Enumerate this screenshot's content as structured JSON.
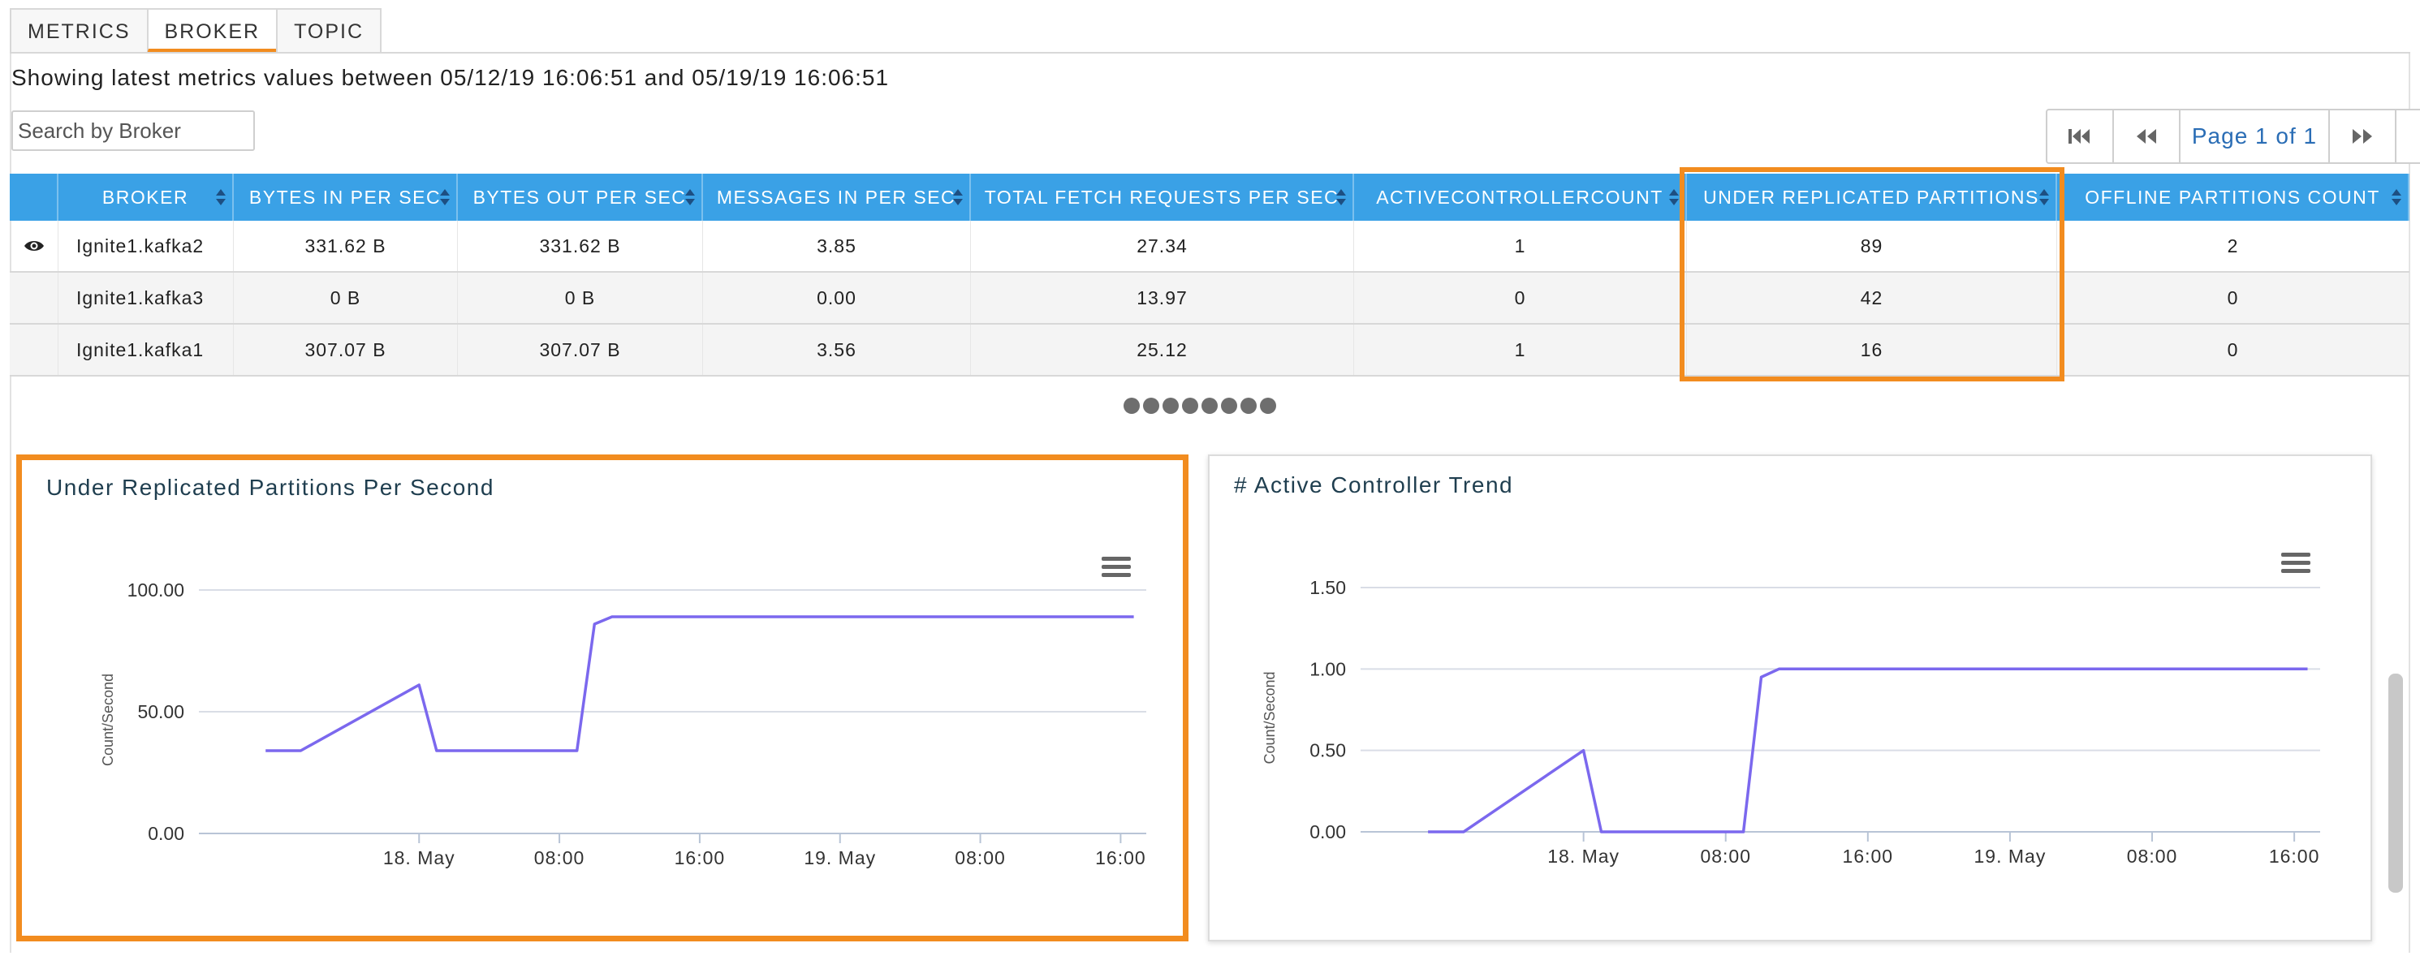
{
  "tabs": [
    {
      "label": "METRICS",
      "active": false
    },
    {
      "label": "BROKER",
      "active": true
    },
    {
      "label": "TOPIC",
      "active": false
    }
  ],
  "range_text": "Showing latest metrics values between 05/12/19 16:06:51 and 05/19/19 16:06:51",
  "search": {
    "placeholder": "Search by Broker",
    "value": ""
  },
  "pager": {
    "label": "Page 1 of 1"
  },
  "table": {
    "columns": [
      "",
      "BROKER",
      "BYTES IN PER SEC",
      "BYTES OUT PER SEC",
      "MESSAGES IN PER SEC",
      "TOTAL FETCH REQUESTS PER SEC",
      "ACTIVECONTROLLERCOUNT",
      "UNDER REPLICATED PARTITIONS",
      "OFFLINE PARTITIONS COUNT"
    ],
    "rows": [
      {
        "broker": "Ignite1.kafka2",
        "bytes_in": "331.62 B",
        "bytes_out": "331.62 B",
        "messages_in": "3.85",
        "fetch": "27.34",
        "active": "1",
        "under_replicated": "89",
        "offline": "2",
        "selected": true
      },
      {
        "broker": "Ignite1.kafka3",
        "bytes_in": "0 B",
        "bytes_out": "0 B",
        "messages_in": "0.00",
        "fetch": "13.97",
        "active": "0",
        "under_replicated": "42",
        "offline": "0",
        "selected": false
      },
      {
        "broker": "Ignite1.kafka1",
        "bytes_in": "307.07 B",
        "bytes_out": "307.07 B",
        "messages_in": "3.56",
        "fetch": "25.12",
        "active": "1",
        "under_replicated": "16",
        "offline": "0",
        "selected": false
      }
    ]
  },
  "colors": {
    "accent": "#f28c1f",
    "header": "#3aa1e6",
    "series": "#7b68ee",
    "link": "#2a6db5"
  },
  "chart_data": [
    {
      "type": "line",
      "title": "Under Replicated Partitions Per Second",
      "ylabel": "Count/Second",
      "xlabel": "",
      "ylim": [
        0,
        100
      ],
      "yticks": [
        "0.00",
        "50.00",
        "100.00"
      ],
      "xticks": [
        "18. May",
        "08:00",
        "16:00",
        "19. May",
        "08:00",
        "16:00"
      ],
      "xlim": [
        "2019-05-17T12:00",
        "2019-05-19T17:00"
      ],
      "xtick_times": [
        "2019-05-18T00:00",
        "2019-05-18T08:00",
        "2019-05-18T16:00",
        "2019-05-19T00:00",
        "2019-05-19T08:00",
        "2019-05-19T16:00"
      ],
      "grid": true,
      "series": [
        {
          "x": [
            "2019-05-17T15:15",
            "2019-05-17T17:15",
            "2019-05-18T00:00",
            "2019-05-18T01:00",
            "2019-05-18T09:00",
            "2019-05-18T10:00",
            "2019-05-18T11:00",
            "2019-05-19T16:45"
          ],
          "values": [
            34,
            34,
            61,
            34,
            34,
            86,
            89,
            89
          ]
        }
      ]
    },
    {
      "type": "line",
      "title": "# Active Controller Trend",
      "ylabel": "Count/Second",
      "xlabel": "",
      "ylim": [
        0,
        1.5
      ],
      "yticks": [
        "0.00",
        "0.50",
        "1.00",
        "1.50"
      ],
      "xticks": [
        "18. May",
        "08:00",
        "16:00",
        "19. May",
        "08:00",
        "16:00"
      ],
      "xlim": [
        "2019-05-17T12:00",
        "2019-05-19T17:00"
      ],
      "xtick_times": [
        "2019-05-18T00:00",
        "2019-05-18T08:00",
        "2019-05-18T16:00",
        "2019-05-19T00:00",
        "2019-05-19T08:00",
        "2019-05-19T16:00"
      ],
      "grid": true,
      "series": [
        {
          "x": [
            "2019-05-17T15:15",
            "2019-05-17T17:15",
            "2019-05-18T00:00",
            "2019-05-18T01:00",
            "2019-05-18T09:00",
            "2019-05-18T10:00",
            "2019-05-18T11:00",
            "2019-05-19T16:45"
          ],
          "values": [
            0,
            0,
            0.5,
            0,
            0,
            0.95,
            1,
            1
          ]
        }
      ]
    }
  ]
}
